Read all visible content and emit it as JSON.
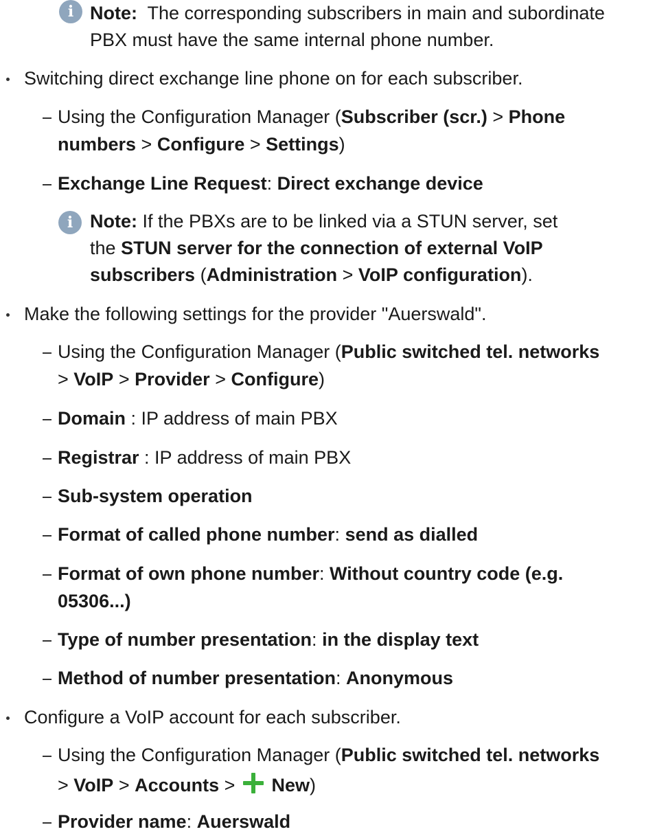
{
  "note1": {
    "label": "Note:",
    "text_line1": "The corresponding subscribers in main and subordinate",
    "text_line2": "PBX must have the same internal phone number."
  },
  "direct_line": {
    "bullet": "Switching direct exchange line phone on for each subscriber.",
    "path_prefix": "Using the Configuration Manager (",
    "path_subscriber": "Subscriber (scr.)",
    "sep": ">",
    "path_phone": "Phone",
    "path_numbers": "numbers",
    "path_configure": "Configure",
    "path_settings": "Settings",
    "close_paren": ")",
    "request_label": "Exchange Line Request",
    "colon": ":",
    "request_value": "Direct exchange device"
  },
  "note2": {
    "label": "Note:",
    "text_a": "If the PBXs are to be linked via a STUN server, set",
    "text_the": "the",
    "stun_line1": "STUN server for the connection of external VoIP",
    "stun_line2": "subscribers",
    "open": "(",
    "admin": "Administration",
    "voip_config": "VoIP configuration",
    "close": ")."
  },
  "provider": {
    "bullet": "Make the following settings for the provider \"Auerswald\".",
    "path_prefix": "Using the Configuration Manager (",
    "path_pstn": "Public switched tel. networks",
    "path_voip": "VoIP",
    "path_provider": "Provider",
    "path_configure": "Configure",
    "domain_label": "Domain",
    "domain_value": " : IP address of main PBX",
    "registrar_label": "Registrar",
    "registrar_value": " : IP address of main PBX",
    "subsystem": "Sub-system operation",
    "called_label": "Format of called phone number",
    "called_value": "send as dialled",
    "own_label": "Format of own phone number",
    "own_value_1": "Without country code (e.g.",
    "own_value_2": "05306...)",
    "type_label": "Type of number presentation",
    "type_value": "in the display text",
    "method_label": "Method of number presentation",
    "method_value": "Anonymous"
  },
  "account": {
    "bullet": "Configure a VoIP account for each subscriber.",
    "path_prefix": "Using the Configuration Manager (",
    "path_pstn": "Public switched tel. networks",
    "path_voip": "VoIP",
    "path_accounts": "Accounts",
    "path_new": "New",
    "provider_label": "Provider name",
    "provider_value": "Auerswald"
  },
  "icons": {
    "info": "info-icon",
    "plus": "plus-icon",
    "info_color": "#8fa6bd",
    "plus_color": "#3bb03a"
  }
}
